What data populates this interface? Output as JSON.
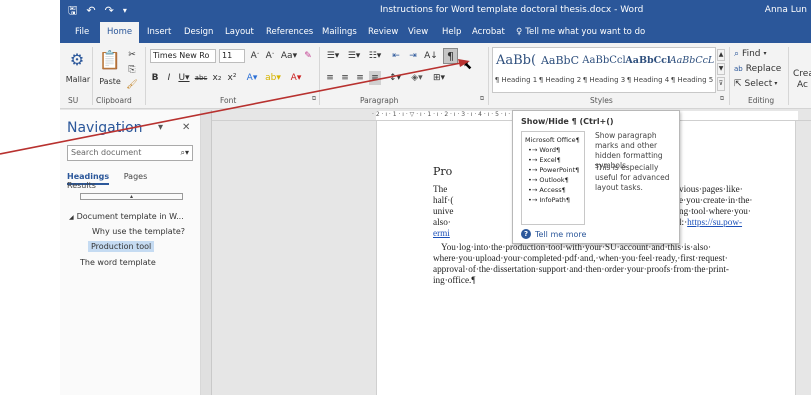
{
  "titlebar": {
    "title": "Instructions for Word template doctoral thesis.docx  -  Word",
    "user": "Anna Lun",
    "qat_icons": [
      "save-icon",
      "undo-icon",
      "redo-icon",
      "customize-icon"
    ]
  },
  "tabs": [
    {
      "label": "File",
      "active": false
    },
    {
      "label": "Home",
      "active": true
    },
    {
      "label": "Insert",
      "active": false
    },
    {
      "label": "Design",
      "active": false
    },
    {
      "label": "Layout",
      "active": false
    },
    {
      "label": "References",
      "active": false
    },
    {
      "label": "Mailings",
      "active": false
    },
    {
      "label": "Review",
      "active": false
    },
    {
      "label": "View",
      "active": false
    },
    {
      "label": "Help",
      "active": false
    },
    {
      "label": "Acrobat",
      "active": false
    }
  ],
  "tell_me": "Tell me what you want to do",
  "ribbon": {
    "mallar_label": "Mallar",
    "su_label": "SU",
    "paste_label": "Paste",
    "clipboard_label": "Clipboard",
    "font_label": "Font",
    "paragraph_label": "Paragraph",
    "styles_label": "Styles",
    "editing_label": "Editing",
    "font_name": "Times New Ro",
    "font_size": "11",
    "find_label": "Find",
    "replace_label": "Replace",
    "select_label": "Select",
    "create_label": "Creat",
    "ac_label": "Ac",
    "styles": [
      {
        "preview": "AaBb(",
        "name": "¶ Heading 1"
      },
      {
        "preview": "AaBbC",
        "name": "¶ Heading 2"
      },
      {
        "preview": "AaBbCcl",
        "name": "¶ Heading 3"
      },
      {
        "preview": "AaBbCcl",
        "name": "¶ Heading 4"
      },
      {
        "preview": "AaBbCcL",
        "name": "¶ Heading 5"
      }
    ]
  },
  "nav": {
    "title": "Navigation",
    "search_placeholder": "Search document",
    "tab_headings": "Headings",
    "tab_pages": "Pages",
    "tab_results": "Results",
    "items": [
      {
        "label": "Document template in W...",
        "level": 1
      },
      {
        "label": "Why use the template?",
        "level": 2
      },
      {
        "label": "Production tool",
        "level": 2,
        "selected": true
      },
      {
        "label": "The word template",
        "level": 1
      }
    ]
  },
  "tooltip": {
    "title": "Show/Hide ¶ (Ctrl+()",
    "desc": "Show paragraph marks and other hidden formatting symbols.",
    "hint": "This is especially useful for advanced layout tasks.",
    "preview_lines": [
      "Microsoft Office¶",
      "•→ Word¶",
      "•→ Excel¶",
      "•→ PowerPoint¶",
      "•→ Outlook¶",
      "•→ Access¶",
      "•→ InfoPath¶"
    ],
    "tell_more": "Tell me more"
  },
  "ruler": {
    "marks": "· 2 · ı · 1 · ı · ▽ · ı · 1 · ı · 2 · ı · 3 · ı · 4 · ı · 5 · ı · 6 · ı · 7 · ı · 8 · ı · 9 · ı · 10 · ı · 11 · ı · △ · ı · 13 · ı · 14"
  },
  "doc": {
    "heading": "Pro",
    "line1_left": "The",
    "line1_right": "vious·pages·like·",
    "line2_left": "half·(",
    "line2_right": "e·you·create·in·the·",
    "line3_left": "unive",
    "line3_right": "ng·tool·where·you·",
    "line4_left": "also·",
    "line4_right": "l:·",
    "link": "https://su.pow-",
    "line5_left": "ermi",
    "para2_line1": "You·log·into·the·production·tool·with·your·SU·account·and·this·is·also·",
    "para2_line2": "where·you·upload·your·completed·pdf·and,·when·you·feel·ready,·first·request·",
    "para2_line3": "approval·of·the·dissertation·support·and·then·order·your·proofs·from·the·print-",
    "para2_line4": "ing·office.¶"
  },
  "colors": {
    "brand": "#2b579a",
    "annotation_arrow": "#b8312f",
    "selection": "#c5dbf2"
  }
}
